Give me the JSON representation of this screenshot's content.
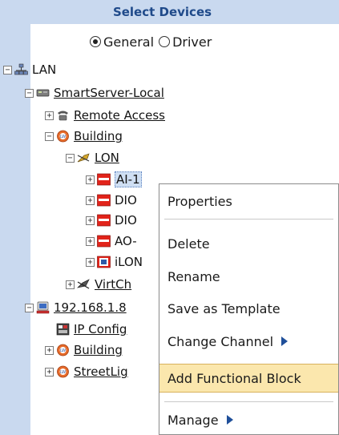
{
  "header": {
    "title": "Select Devices"
  },
  "view_mode": {
    "options": [
      "General",
      "Driver"
    ],
    "selected": "General"
  },
  "tree": {
    "lan": "LAN",
    "smartserver": "SmartServer-Local",
    "remote_access": "Remote Access",
    "building": "Building",
    "lon": "LON",
    "ai1": "AI-1",
    "dio1": "DIO",
    "dio2": "DIO",
    "ao": "AO-",
    "ilon": "iLON",
    "virtch": "VirtCh",
    "ip_node": "192.168.1.8",
    "ip_config": "IP Config",
    "building2": "Building",
    "streetlight": "StreetLig"
  },
  "context_menu": {
    "properties": "Properties",
    "delete": "Delete",
    "rename": "Rename",
    "save_as_template": "Save as Template",
    "change_channel": "Change Channel",
    "add_functional_block": "Add Functional Block",
    "manage": "Manage",
    "highlighted": "Add Functional Block"
  },
  "colors": {
    "panel_bg": "#c9d9ef",
    "header_text": "#1f4a8a",
    "menu_highlight": "#fbe7ad",
    "submenu_arrow": "#1f4f9a"
  }
}
